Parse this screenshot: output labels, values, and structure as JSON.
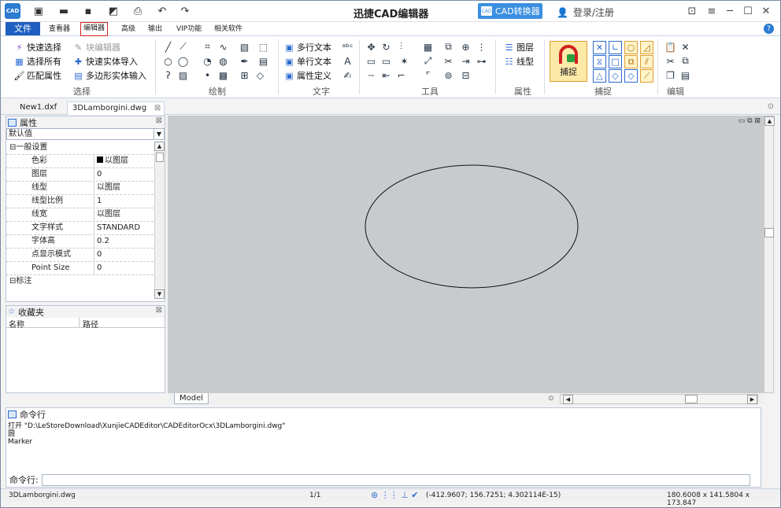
{
  "app": {
    "title": "迅捷CAD编辑器",
    "logo": "CAD",
    "converter_button": "CAD转换器",
    "login": "登录/注册"
  },
  "menu": [
    "文件",
    "查看器",
    "编辑器",
    "高级",
    "输出",
    "VIP功能",
    "相关软件"
  ],
  "ribbon": {
    "select_group": {
      "label": "选择",
      "items": [
        "快速选择",
        "块编辑器",
        "选择所有",
        "快速实体导入",
        "匹配属性",
        "多边形实体输入"
      ]
    },
    "draw_group": {
      "label": "绘制"
    },
    "text_group": {
      "label": "文字",
      "items": [
        "多行文本",
        "单行文本",
        "属性定义"
      ]
    },
    "tools_group": {
      "label": "工具"
    },
    "props_group": {
      "label": "属性",
      "items": [
        "图层",
        "线型"
      ]
    },
    "snap_group": {
      "label": "捕捉",
      "big_button": "捕捉"
    },
    "edit_group": {
      "label": "编辑"
    }
  },
  "doc_tabs": [
    "New1.dxf",
    "3DLamborgini.dwg"
  ],
  "properties_panel": {
    "title": "属性",
    "dropdown": "默认值",
    "section_general": "一般设置",
    "rows": [
      {
        "k": "色彩",
        "v": "以图层"
      },
      {
        "k": "图层",
        "v": "0"
      },
      {
        "k": "线型",
        "v": "以图层"
      },
      {
        "k": "线型比例",
        "v": "1"
      },
      {
        "k": "线宽",
        "v": "以图层"
      },
      {
        "k": "文字样式",
        "v": "STANDARD"
      },
      {
        "k": "字体高",
        "v": "0.2"
      },
      {
        "k": "点显示模式",
        "v": "0"
      },
      {
        "k": "Point Size",
        "v": "0"
      }
    ],
    "section_dim": "标注"
  },
  "favorites_panel": {
    "title": "收藏夹",
    "col_name": "名称",
    "col_path": "路径"
  },
  "canvas": {
    "model_tab": "Model"
  },
  "command": {
    "title": "命令行",
    "lines": [
      "打开 \"D:\\LeStoreDownload\\XunjieCADEditor\\CADEditorOcx\\3DLamborgini.dwg\"",
      "圆",
      "Marker"
    ],
    "prompt": "命令行:"
  },
  "status": {
    "file": "3DLamborgini.dwg",
    "page": "1/1",
    "coords": "(-412.9607; 156.7251; 4.302114E-15)",
    "size": "180.6008 x 141.5804 x 173.847"
  },
  "colors": {
    "accent": "#1f5fbf",
    "highlight": "#d32020",
    "canvas": "#c8cbce"
  }
}
